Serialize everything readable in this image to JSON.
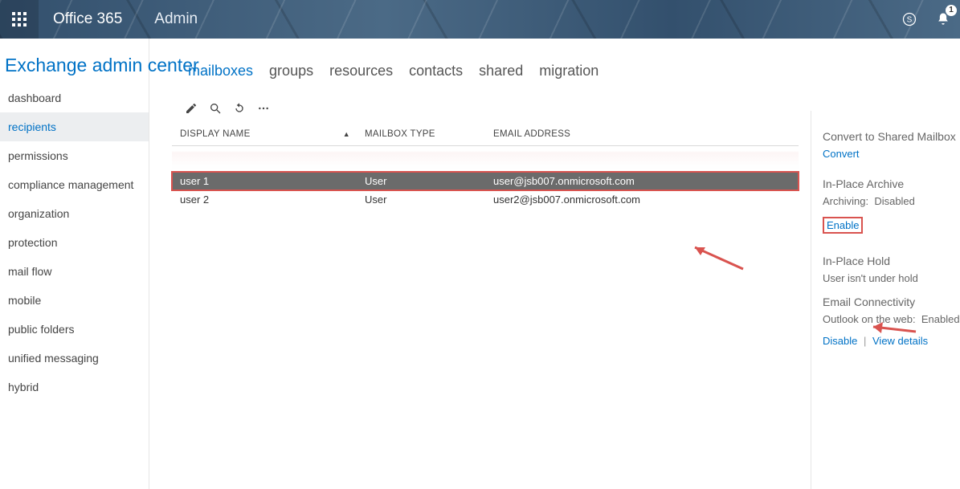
{
  "topbar": {
    "brand": "Office 365",
    "admin_label": "Admin",
    "notification_count": "1"
  },
  "page_title": "Exchange admin center",
  "leftnav": {
    "items": [
      {
        "label": "dashboard",
        "active": false
      },
      {
        "label": "recipients",
        "active": true
      },
      {
        "label": "permissions",
        "active": false
      },
      {
        "label": "compliance management",
        "active": false
      },
      {
        "label": "organization",
        "active": false
      },
      {
        "label": "protection",
        "active": false
      },
      {
        "label": "mail flow",
        "active": false
      },
      {
        "label": "mobile",
        "active": false
      },
      {
        "label": "public folders",
        "active": false
      },
      {
        "label": "unified messaging",
        "active": false
      },
      {
        "label": "hybrid",
        "active": false
      }
    ]
  },
  "tabs": {
    "items": [
      {
        "label": "mailboxes",
        "active": true
      },
      {
        "label": "groups",
        "active": false
      },
      {
        "label": "resources",
        "active": false
      },
      {
        "label": "contacts",
        "active": false
      },
      {
        "label": "shared",
        "active": false
      },
      {
        "label": "migration",
        "active": false
      }
    ]
  },
  "grid": {
    "columns": {
      "display_name": "DISPLAY NAME",
      "mailbox_type": "MAILBOX TYPE",
      "email_address": "EMAIL ADDRESS"
    },
    "sort_indicator": "▲",
    "rows": [
      {
        "display_name": "user 1",
        "mailbox_type": "User",
        "email_address": "user@jsb007.onmicrosoft.com",
        "selected": true
      },
      {
        "display_name": "user 2",
        "mailbox_type": "User",
        "email_address": "user2@jsb007.onmicrosoft.com",
        "selected": false
      }
    ]
  },
  "details": {
    "convert_heading": "Convert to Shared Mailbox",
    "convert_link": "Convert",
    "archive_heading": "In-Place Archive",
    "archive_status_label": "Archiving:",
    "archive_status_value": "Disabled",
    "archive_enable": "Enable",
    "hold_heading": "In-Place Hold",
    "hold_status": "User isn't under hold",
    "email_conn_heading": "Email Connectivity",
    "owa_label": "Outlook on the web:",
    "owa_value": "Enabled",
    "disable_link": "Disable",
    "separator": "|",
    "view_details_link": "View details"
  }
}
